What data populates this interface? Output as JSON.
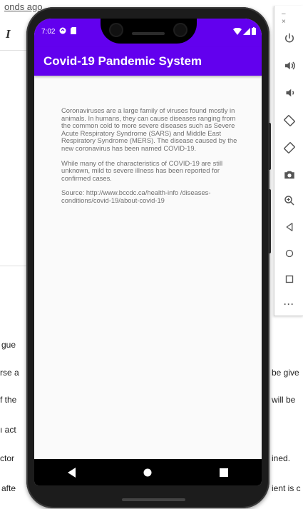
{
  "background_doc": {
    "link_fragment": "onds ago",
    "italic_button": "I",
    "lines": [
      {
        "left": "gue",
        "right": ""
      },
      {
        "left": "rse a",
        "right": "be give"
      },
      {
        "left": "f the",
        "right": "will be"
      },
      {
        "left": "ı act",
        "right": ""
      },
      {
        "left": "ctor",
        "right": "ined."
      },
      {
        "left": "afte",
        "right": "ient is c"
      }
    ]
  },
  "emulator_toolbar": {
    "window_controls": "– ×",
    "buttons": [
      "power-icon",
      "volume-up-icon",
      "volume-down-icon",
      "rotate-left-icon",
      "rotate-right-icon",
      "camera-icon",
      "zoom-icon",
      "back-icon",
      "home-icon",
      "overview-icon",
      "more-icon"
    ],
    "more_label": "···"
  },
  "phone": {
    "status_bar": {
      "time": "7:02",
      "background": "#6200ee"
    },
    "app_bar": {
      "title": "Covid-19 Pandemic System",
      "color": "#6200ee"
    },
    "content": {
      "paragraph_1": "Coronaviruses are a large family of viruses found mostly in animals. In humans, they can cause diseases ranging from the common cold to more severe diseases such as Severe Acute Respiratory Syndrome (SARS) and Middle East Respiratory Syndrome (MERS). The disease caused by the new coronavirus has been named COVID-19.",
      "paragraph_2": "While many of the characteristics of COVID-19 are still unknown, mild to severe illness has been reported for confirmed cases.",
      "paragraph_3": "Source: http://www.bccdc.ca/health-info /diseases-conditions/covid-19/about-covid-19"
    },
    "nav_bar": [
      "back-icon",
      "home-icon",
      "overview-icon"
    ]
  }
}
